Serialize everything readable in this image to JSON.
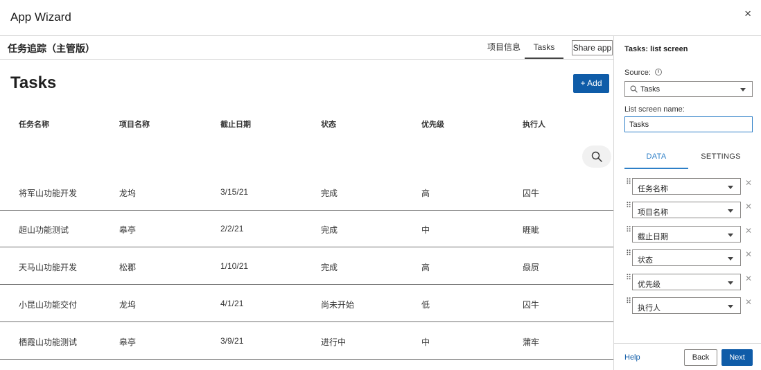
{
  "window": {
    "title": "App Wizard",
    "close_glyph": "×"
  },
  "appbar": {
    "app_name": "任务追踪（主管版）",
    "nav": {
      "info": "项目信息",
      "tasks": "Tasks"
    },
    "share_label": "Share app"
  },
  "main": {
    "title": "Tasks",
    "add_label": "+ Add",
    "columns": [
      "任务名称",
      "项目名称",
      "截止日期",
      "状态",
      "优先级",
      "执行人"
    ],
    "rows": [
      [
        "将军山功能开发",
        "龙坞",
        "3/15/21",
        "完成",
        "高",
        "囚牛"
      ],
      [
        "超山功能测试",
        "皋亭",
        "2/2/21",
        "完成",
        "中",
        "睚眦"
      ],
      [
        "天马山功能开发",
        "松郡",
        "1/10/21",
        "完成",
        "高",
        "赑屃"
      ],
      [
        "小昆山功能交付",
        "龙坞",
        "4/1/21",
        "尚未开始",
        "低",
        "囚牛"
      ],
      [
        "栖霞山功能测试",
        "皋亭",
        "3/9/21",
        "进行中",
        "中",
        "蒲牢"
      ]
    ]
  },
  "sidebar": {
    "title": "Tasks: list screen",
    "source_label": "Source:",
    "source_info_icon": "info-icon",
    "source_value": "Tasks",
    "name_label": "List screen name:",
    "name_value": "Tasks",
    "tabs": {
      "data": "DATA",
      "settings": "SETTINGS"
    },
    "fields": [
      "任务名称",
      "项目名称",
      "截止日期",
      "状态",
      "优先级",
      "执行人"
    ],
    "help": "Help",
    "back": "Back",
    "next": "Next"
  },
  "colors": {
    "primary": "#0f5ca8",
    "accent": "#2d7fc7",
    "border": "#d6d6d6",
    "row_divider": "#707070"
  }
}
